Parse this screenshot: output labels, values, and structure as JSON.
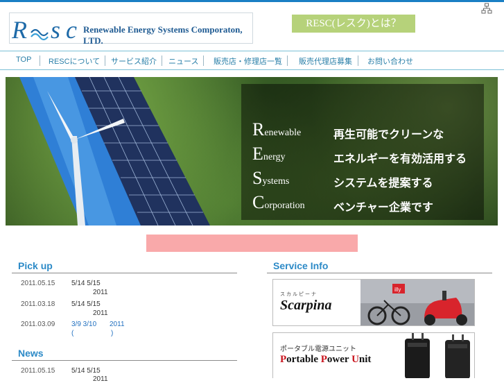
{
  "brand": {
    "logo": "RESC",
    "company_name": "Renewable Energy Systems Comporaton, LTD."
  },
  "nav": {
    "items": [
      "TOP",
      "RESCについて",
      "サービス紹介",
      "ニュース",
      "販売店・修理店一覧",
      "販売代理店募集",
      "お問い合わせ"
    ]
  },
  "hero": {
    "title": "RESC(レスク)とは？",
    "rows": [
      {
        "letter": "R",
        "rest": "enewable",
        "jp": "再生可能でクリーンな"
      },
      {
        "letter": "E",
        "rest": "nergy",
        "jp": "エネルギーを有効活用する"
      },
      {
        "letter": "S",
        "rest": "ystems",
        "jp": "システムを提案する"
      },
      {
        "letter": "C",
        "rest": "orporation",
        "jp": "ベンチャー企業です"
      }
    ]
  },
  "pickup": {
    "heading": "Pick up",
    "entries": [
      {
        "date": "2011.05.15",
        "line1": "5/14 5/15",
        "line2": "2011",
        "link": false
      },
      {
        "date": "2011.03.18",
        "line1": "5/14 5/15",
        "line2": "2011",
        "link": false
      },
      {
        "date": "2011.03.09",
        "line1": "3/9 3/10",
        "line1b": "2011",
        "line2": "(",
        "line2b": ")",
        "link": true
      }
    ]
  },
  "news": {
    "heading": "News",
    "entries": [
      {
        "date": "2011.05.15",
        "line1": "5/14 5/15",
        "line2": "2011"
      }
    ]
  },
  "service": {
    "heading": "Service Info",
    "banner1": {
      "brand": "Scarpina",
      "ruby": "スカルピーナ",
      "badge": "illy"
    },
    "banner2": {
      "kicker": "ポータブル電源ユニット",
      "title_p": "P",
      "title_1": "ortable ",
      "title_p2": "P",
      "title_2": "ower ",
      "title_u": "U",
      "title_3": "nit"
    }
  },
  "colors": {
    "accent": "#2c8ac7",
    "nav_text": "#2a7fa8",
    "pink_bar": "#f9a9aa",
    "hero_title_bg": "#b6d27a",
    "banner_red": "#c9151e"
  },
  "icons": {
    "sitemap": "sitemap-icon"
  }
}
